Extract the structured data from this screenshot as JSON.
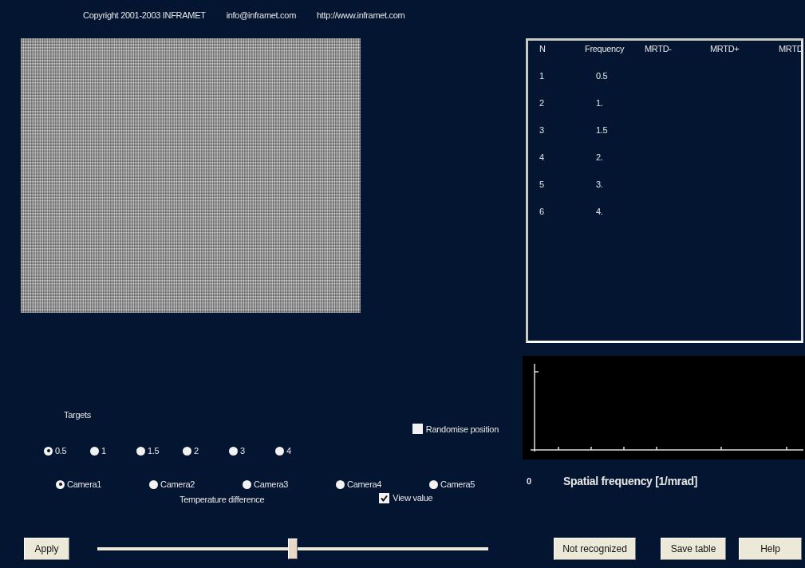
{
  "header": {
    "copyright": "Copyright 2001-2003  INFRAMET",
    "email": "info@inframet.com",
    "url": "http://www.inframet.com"
  },
  "table": {
    "columns": [
      "N",
      "Frequency",
      "MRTD-",
      "MRTD+",
      "MRTD"
    ],
    "rows": [
      [
        "1",
        "0.5"
      ],
      [
        "2",
        "1."
      ],
      [
        "3",
        "1.5"
      ],
      [
        "4",
        "2."
      ],
      [
        "5",
        "3."
      ],
      [
        "6",
        "4."
      ]
    ]
  },
  "chart": {
    "origin_label": "0",
    "xlabel": "Spatial frequency  [1/mrad]"
  },
  "targets": {
    "label": "Targets",
    "options": [
      {
        "label": "0.5",
        "selected": true
      },
      {
        "label": "1",
        "selected": false
      },
      {
        "label": "1.5",
        "selected": false
      },
      {
        "label": "2",
        "selected": false
      },
      {
        "label": "3",
        "selected": false
      },
      {
        "label": "4",
        "selected": false
      }
    ]
  },
  "randomise": {
    "label": "Randomise position",
    "checked": false
  },
  "cameras": [
    {
      "label": "Camera1",
      "selected": true
    },
    {
      "label": "Camera2",
      "selected": false
    },
    {
      "label": "Camera3",
      "selected": false
    },
    {
      "label": "Camera4",
      "selected": false
    },
    {
      "label": "Camera5",
      "selected": false
    }
  ],
  "view_value": {
    "label": "View  value",
    "checked": true
  },
  "temperature": {
    "label": "Temperature difference",
    "level": 0.5
  },
  "apply_button": "Apply",
  "buttons": [
    "Not recognized",
    "Save table",
    "Help"
  ]
}
